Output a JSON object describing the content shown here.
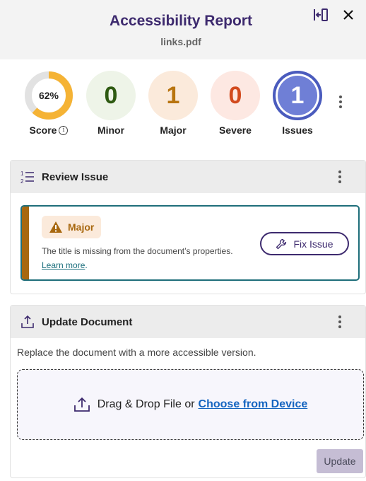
{
  "header": {
    "title": "Accessibility Report",
    "filename": "links.pdf"
  },
  "stats": {
    "score": {
      "value": "62%",
      "fraction": 0.62,
      "label": "Score",
      "color": "#f5b335"
    },
    "minor": {
      "value": "0",
      "label": "Minor"
    },
    "major": {
      "value": "1",
      "label": "Major"
    },
    "severe": {
      "value": "0",
      "label": "Severe"
    },
    "issues": {
      "value": "1",
      "label": "Issues"
    }
  },
  "review": {
    "title": "Review Issue",
    "badge": "Major",
    "message": "The title is missing from the document’s properties.",
    "learn_more": "Learn more",
    "fix_button": "Fix Issue"
  },
  "update": {
    "title": "Update Document",
    "description": "Replace the document with a more accessible version.",
    "drop_text": "Drag & Drop File or",
    "choose_link": "Choose from Device",
    "update_button": "Update"
  },
  "colors": {
    "accent": "#3d2a6e",
    "major": "#a8680f",
    "teal": "#1e6e7a"
  }
}
